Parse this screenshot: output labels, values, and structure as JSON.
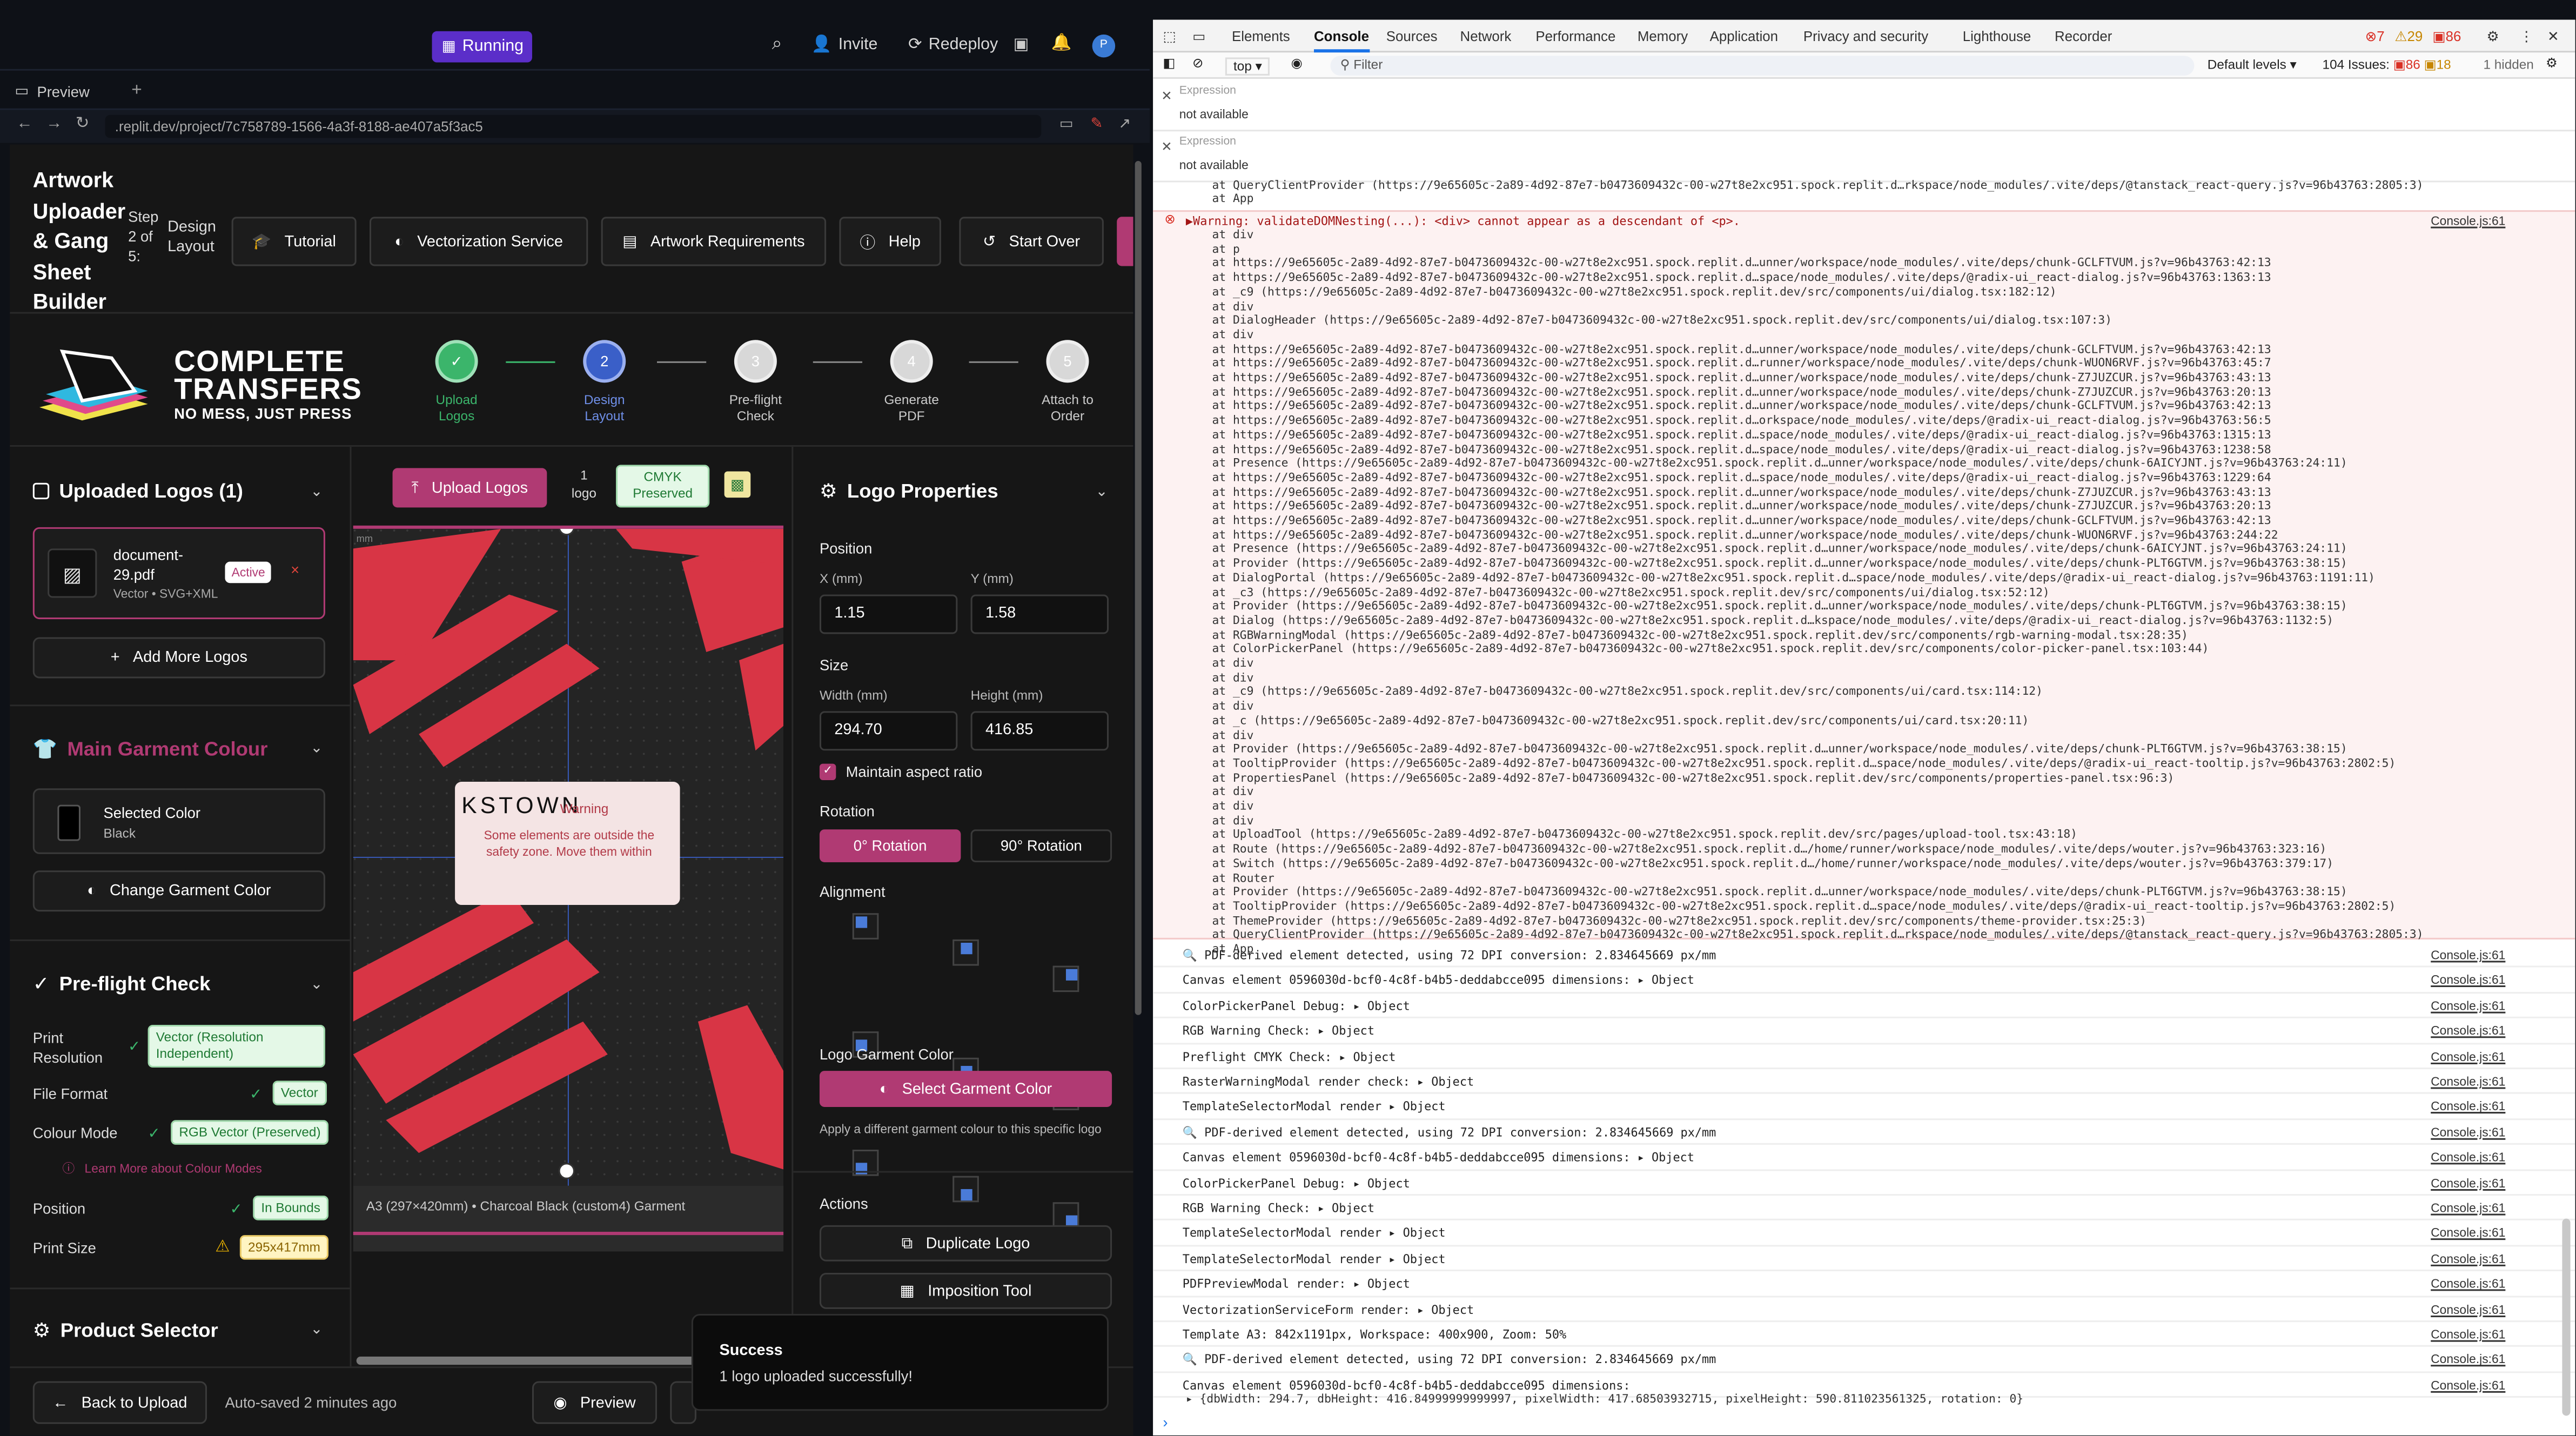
{
  "replit": {
    "running": "Running",
    "invite": "Invite",
    "redeploy": "Redeploy",
    "tab_preview": "Preview",
    "url": ".replit.dev/project/7c758789-1566-4a3f-8188-ae407a5f3ac5",
    "avatar": "P"
  },
  "app": {
    "title_lines": [
      "Artwork",
      "Uploader",
      "& Gang",
      "Sheet",
      "Builder"
    ],
    "step_lines": [
      "Step",
      "2 of",
      "5:"
    ],
    "step_name_lines": [
      "Design",
      "Layout"
    ],
    "buttons": {
      "tutorial": "Tutorial",
      "vectorization": "Vectorization Service",
      "requirements": "Artwork Requirements",
      "help": "Help",
      "start_over": "Start Over"
    },
    "logo": {
      "line1": "COMPLETE",
      "line2": "TRANSFERS",
      "tagline": "NO MESS, JUST PRESS"
    },
    "steps": [
      {
        "num": "✓",
        "label1": "Upload",
        "label2": "Logos"
      },
      {
        "num": "2",
        "label1": "Design",
        "label2": "Layout"
      },
      {
        "num": "3",
        "label1": "Pre-flight",
        "label2": "Check"
      },
      {
        "num": "4",
        "label1": "Generate",
        "label2": "PDF"
      },
      {
        "num": "5",
        "label1": "Attach to",
        "label2": "Order"
      }
    ],
    "uploaded": {
      "title": "Uploaded Logos (1)",
      "file_name_1": "document-",
      "file_name_2": "29.pdf",
      "file_meta": "Vector • SVG+XML",
      "active": "Active",
      "add_more": "Add More Logos"
    },
    "garment": {
      "title": "Main Garment Colour",
      "selected_label": "Selected Color",
      "selected_value": "Black",
      "change": "Change Garment Color"
    },
    "preflight": {
      "title": "Pre-flight Check",
      "rows": [
        {
          "label1": "Print",
          "label2": "Resolution",
          "value": "Vector (Resolution Independent)"
        },
        {
          "label1": "File Format",
          "label2": "",
          "value": "Vector"
        },
        {
          "label1": "Colour Mode",
          "label2": "",
          "value": "RGB Vector (Preserved)"
        },
        {
          "label1": "Position",
          "label2": "",
          "value": "In Bounds"
        },
        {
          "label1": "Print Size",
          "label2": "",
          "value": "295x417mm"
        }
      ],
      "learn_more": "Learn More about Colour Modes"
    },
    "product_selector": "Product Selector",
    "canvas_toolbar": {
      "upload": "Upload Logos",
      "count1": "1",
      "count2": "logo",
      "cmyk1": "CMYK",
      "cmyk2": "Preserved"
    },
    "canvas": {
      "ruler_unit": "mm",
      "warning_title": "KSTOWN",
      "warning_label": "Warning",
      "warning_text": "Some elements are outside the safety zone. Move them within",
      "footer_info": "A3 (297×420mm) • Charcoal Black (custom4) Garment"
    },
    "props": {
      "title": "Logo Properties",
      "position": "Position",
      "x_label": "X (mm)",
      "x_value": "1.15",
      "y_label": "Y (mm)",
      "y_value": "1.58",
      "size": "Size",
      "w_label": "Width (mm)",
      "w_value": "294.70",
      "h_label": "Height (mm)",
      "h_value": "416.85",
      "aspect": "Maintain aspect ratio",
      "rotation": "Rotation",
      "rot0": "0° Rotation",
      "rot90": "90° Rotation",
      "alignment": "Alignment",
      "garment_color": "Logo Garment Color",
      "select_garment": "Select Garment Color",
      "garment_help": "Apply a different garment colour to this specific logo",
      "actions": "Actions",
      "duplicate": "Duplicate Logo",
      "imposition": "Imposition Tool"
    },
    "footer": {
      "back": "Back to Upload",
      "autosave": "Auto-saved 2 minutes ago",
      "preview": "Preview"
    },
    "toast": {
      "title": "Success",
      "text": "1 logo uploaded successfully!"
    }
  },
  "devtools": {
    "tabs": [
      "Elements",
      "Console",
      "Sources",
      "Network",
      "Performance",
      "Memory",
      "Application",
      "Privacy and security",
      "Lighthouse",
      "Recorder"
    ],
    "counts": {
      "errors": "7",
      "warnings": "29",
      "info": "86"
    },
    "context": "top",
    "filter": "Filter",
    "levels": "Default levels",
    "issues": "104 Issues:",
    "issue_err": "86",
    "issue_info": "18",
    "hidden": "1 hidden",
    "expr_label": "Expression",
    "expr_value": "not available",
    "pre_lines": [
      "at QueryClientProvider (https://9e65605c-2a89-4d92-87e7-b0473609432c-00-w27t8e2xc951.spock.replit.d…rkspace/node_modules/.vite/deps/@tanstack_react-query.js?v=96b43763:2805:3)",
      "at App"
    ],
    "error_head": "▶Warning: validateDOMNesting(...): <div> cannot appear as a descendant of <p>.",
    "error_src": "Console.js:61",
    "stack": [
      "at div",
      "at p",
      "at https://9e65605c-2a89-4d92-87e7-b0473609432c-00-w27t8e2xc951.spock.replit.d…unner/workspace/node_modules/.vite/deps/chunk-GCLFTVUM.js?v=96b43763:42:13",
      "at https://9e65605c-2a89-4d92-87e7-b0473609432c-00-w27t8e2xc951.spock.replit.d…space/node_modules/.vite/deps/@radix-ui_react-dialog.js?v=96b43763:1363:13",
      "at _c9 (https://9e65605c-2a89-4d92-87e7-b0473609432c-00-w27t8e2xc951.spock.replit.dev/src/components/ui/dialog.tsx:182:12)",
      "at div",
      "at DialogHeader (https://9e65605c-2a89-4d92-87e7-b0473609432c-00-w27t8e2xc951.spock.replit.dev/src/components/ui/dialog.tsx:107:3)",
      "at div",
      "at https://9e65605c-2a89-4d92-87e7-b0473609432c-00-w27t8e2xc951.spock.replit.d…unner/workspace/node_modules/.vite/deps/chunk-GCLFTVUM.js?v=96b43763:42:13",
      "at https://9e65605c-2a89-4d92-87e7-b0473609432c-00-w27t8e2xc951.spock.replit.d…runner/workspace/node_modules/.vite/deps/chunk-WUON6RVF.js?v=96b43763:45:7",
      "at https://9e65605c-2a89-4d92-87e7-b0473609432c-00-w27t8e2xc951.spock.replit.d…unner/workspace/node_modules/.vite/deps/chunk-Z7JUZCUR.js?v=96b43763:43:13",
      "at https://9e65605c-2a89-4d92-87e7-b0473609432c-00-w27t8e2xc951.spock.replit.d…unner/workspace/node_modules/.vite/deps/chunk-Z7JUZCUR.js?v=96b43763:20:13",
      "at https://9e65605c-2a89-4d92-87e7-b0473609432c-00-w27t8e2xc951.spock.replit.d…unner/workspace/node_modules/.vite/deps/chunk-GCLFTVUM.js?v=96b43763:42:13",
      "at https://9e65605c-2a89-4d92-87e7-b0473609432c-00-w27t8e2xc951.spock.replit.d…orkspace/node_modules/.vite/deps/@radix-ui_react-dialog.js?v=96b43763:56:5",
      "at https://9e65605c-2a89-4d92-87e7-b0473609432c-00-w27t8e2xc951.spock.replit.d…space/node_modules/.vite/deps/@radix-ui_react-dialog.js?v=96b43763:1315:13",
      "at https://9e65605c-2a89-4d92-87e7-b0473609432c-00-w27t8e2xc951.spock.replit.d…space/node_modules/.vite/deps/@radix-ui_react-dialog.js?v=96b43763:1238:58",
      "at Presence (https://9e65605c-2a89-4d92-87e7-b0473609432c-00-w27t8e2xc951.spock.replit.d…unner/workspace/node_modules/.vite/deps/chunk-6AICYJNT.js?v=96b43763:24:11)",
      "at https://9e65605c-2a89-4d92-87e7-b0473609432c-00-w27t8e2xc951.spock.replit.d…space/node_modules/.vite/deps/@radix-ui_react-dialog.js?v=96b43763:1229:64",
      "at https://9e65605c-2a89-4d92-87e7-b0473609432c-00-w27t8e2xc951.spock.replit.d…unner/workspace/node_modules/.vite/deps/chunk-Z7JUZCUR.js?v=96b43763:43:13",
      "at https://9e65605c-2a89-4d92-87e7-b0473609432c-00-w27t8e2xc951.spock.replit.d…unner/workspace/node_modules/.vite/deps/chunk-Z7JUZCUR.js?v=96b43763:20:13",
      "at https://9e65605c-2a89-4d92-87e7-b0473609432c-00-w27t8e2xc951.spock.replit.d…unner/workspace/node_modules/.vite/deps/chunk-GCLFTVUM.js?v=96b43763:42:13",
      "at https://9e65605c-2a89-4d92-87e7-b0473609432c-00-w27t8e2xc951.spock.replit.d…unner/workspace/node_modules/.vite/deps/chunk-WUON6RVF.js?v=96b43763:244:22",
      "at Presence (https://9e65605c-2a89-4d92-87e7-b0473609432c-00-w27t8e2xc951.spock.replit.d…unner/workspace/node_modules/.vite/deps/chunk-6AICYJNT.js?v=96b43763:24:11)",
      "at Provider (https://9e65605c-2a89-4d92-87e7-b0473609432c-00-w27t8e2xc951.spock.replit.d…unner/workspace/node_modules/.vite/deps/chunk-PLT6GTVM.js?v=96b43763:38:15)",
      "at DialogPortal (https://9e65605c-2a89-4d92-87e7-b0473609432c-00-w27t8e2xc951.spock.replit.d…space/node_modules/.vite/deps/@radix-ui_react-dialog.js?v=96b43763:1191:11)",
      "at _c3 (https://9e65605c-2a89-4d92-87e7-b0473609432c-00-w27t8e2xc951.spock.replit.dev/src/components/ui/dialog.tsx:52:12)",
      "at Provider (https://9e65605c-2a89-4d92-87e7-b0473609432c-00-w27t8e2xc951.spock.replit.d…unner/workspace/node_modules/.vite/deps/chunk-PLT6GTVM.js?v=96b43763:38:15)",
      "at Dialog (https://9e65605c-2a89-4d92-87e7-b0473609432c-00-w27t8e2xc951.spock.replit.d…kspace/node_modules/.vite/deps/@radix-ui_react-dialog.js?v=96b43763:1132:5)",
      "at RGBWarningModal (https://9e65605c-2a89-4d92-87e7-b0473609432c-00-w27t8e2xc951.spock.replit.dev/src/components/rgb-warning-modal.tsx:28:35)",
      "at ColorPickerPanel (https://9e65605c-2a89-4d92-87e7-b0473609432c-00-w27t8e2xc951.spock.replit.dev/src/components/color-picker-panel.tsx:103:44)",
      "at div",
      "at div",
      "at _c9 (https://9e65605c-2a89-4d92-87e7-b0473609432c-00-w27t8e2xc951.spock.replit.dev/src/components/ui/card.tsx:114:12)",
      "at div",
      "at _c (https://9e65605c-2a89-4d92-87e7-b0473609432c-00-w27t8e2xc951.spock.replit.dev/src/components/ui/card.tsx:20:11)",
      "at div",
      "at Provider (https://9e65605c-2a89-4d92-87e7-b0473609432c-00-w27t8e2xc951.spock.replit.d…unner/workspace/node_modules/.vite/deps/chunk-PLT6GTVM.js?v=96b43763:38:15)",
      "at TooltipProvider (https://9e65605c-2a89-4d92-87e7-b0473609432c-00-w27t8e2xc951.spock.replit.d…space/node_modules/.vite/deps/@radix-ui_react-tooltip.js?v=96b43763:2802:5)",
      "at PropertiesPanel (https://9e65605c-2a89-4d92-87e7-b0473609432c-00-w27t8e2xc951.spock.replit.dev/src/components/properties-panel.tsx:96:3)",
      "at div",
      "at div",
      "at div",
      "at UploadTool (https://9e65605c-2a89-4d92-87e7-b0473609432c-00-w27t8e2xc951.spock.replit.dev/src/pages/upload-tool.tsx:43:18)",
      "at Route (https://9e65605c-2a89-4d92-87e7-b0473609432c-00-w27t8e2xc951.spock.replit.d…/home/runner/workspace/node_modules/.vite/deps/wouter.js?v=96b43763:323:16)",
      "at Switch (https://9e65605c-2a89-4d92-87e7-b0473609432c-00-w27t8e2xc951.spock.replit.d…/home/runner/workspace/node_modules/.vite/deps/wouter.js?v=96b43763:379:17)",
      "at Router",
      "at Provider (https://9e65605c-2a89-4d92-87e7-b0473609432c-00-w27t8e2xc951.spock.replit.d…unner/workspace/node_modules/.vite/deps/chunk-PLT6GTVM.js?v=96b43763:38:15)",
      "at TooltipProvider (https://9e65605c-2a89-4d92-87e7-b0473609432c-00-w27t8e2xc951.spock.replit.d…space/node_modules/.vite/deps/@radix-ui_react-tooltip.js?v=96b43763:2802:5)",
      "at ThemeProvider (https://9e65605c-2a89-4d92-87e7-b0473609432c-00-w27t8e2xc951.spock.replit.dev/src/components/theme-provider.tsx:25:3)",
      "at QueryClientProvider (https://9e65605c-2a89-4d92-87e7-b0473609432c-00-w27t8e2xc951.spock.replit.d…rkspace/node_modules/.vite/deps/@tanstack_react-query.js?v=96b43763:2805:3)",
      "at App"
    ],
    "logs": [
      {
        "text": "🔍 PDF-derived element detected, using 72 DPI conversion: 2.834645669 px/mm",
        "src": "Console.js:61"
      },
      {
        "text": "Canvas element 0596030d-bcf0-4c8f-b4b5-deddabcce095 dimensions: ▸ Object",
        "src": "Console.js:61"
      },
      {
        "text": "ColorPickerPanel Debug: ▸ Object",
        "src": "Console.js:61"
      },
      {
        "text": "RGB Warning Check: ▸ Object",
        "src": "Console.js:61"
      },
      {
        "text": "Preflight CMYK Check: ▸ Object",
        "src": "Console.js:61"
      },
      {
        "text": "RasterWarningModal render check: ▸ Object",
        "src": "Console.js:61"
      },
      {
        "text": "TemplateSelectorModal render ▸ Object",
        "src": "Console.js:61"
      },
      {
        "text": "🔍 PDF-derived element detected, using 72 DPI conversion: 2.834645669 px/mm",
        "src": "Console.js:61"
      },
      {
        "text": "Canvas element 0596030d-bcf0-4c8f-b4b5-deddabcce095 dimensions: ▸ Object",
        "src": "Console.js:61"
      },
      {
        "text": "ColorPickerPanel Debug: ▸ Object",
        "src": "Console.js:61"
      },
      {
        "text": "RGB Warning Check: ▸ Object",
        "src": "Console.js:61"
      },
      {
        "text": "TemplateSelectorModal render ▸ Object",
        "src": "Console.js:61"
      },
      {
        "text": "TemplateSelectorModal render ▸ Object",
        "src": "Console.js:61"
      },
      {
        "text": "PDFPreviewModal render: ▸ Object",
        "src": "Console.js:61"
      },
      {
        "text": "VectorizationServiceForm render: ▸ Object",
        "src": "Console.js:61"
      },
      {
        "text": "Template A3: 842x1191px, Workspace: 400x900, Zoom: 50%",
        "src": "Console.js:61"
      },
      {
        "text": "🔍 PDF-derived element detected, using 72 DPI conversion: 2.834645669 px/mm",
        "src": "Console.js:61"
      },
      {
        "text": "Canvas element 0596030d-bcf0-4c8f-b4b5-deddabcce095 dimensions:",
        "src": "Console.js:61"
      }
    ],
    "last_obj": "▸ {dbWidth: 294.7, dbHeight: 416.84999999999997, pixelWidth: 417.68503932715, pixelHeight: 590.811023561325, rotation: 0}",
    "prompt": "›"
  },
  "colors": {
    "accent_purple": "#b03a73",
    "stepper_active": "#3a5fc8",
    "stepper_done": "#3bb56b",
    "logo_red": "#d83545"
  }
}
